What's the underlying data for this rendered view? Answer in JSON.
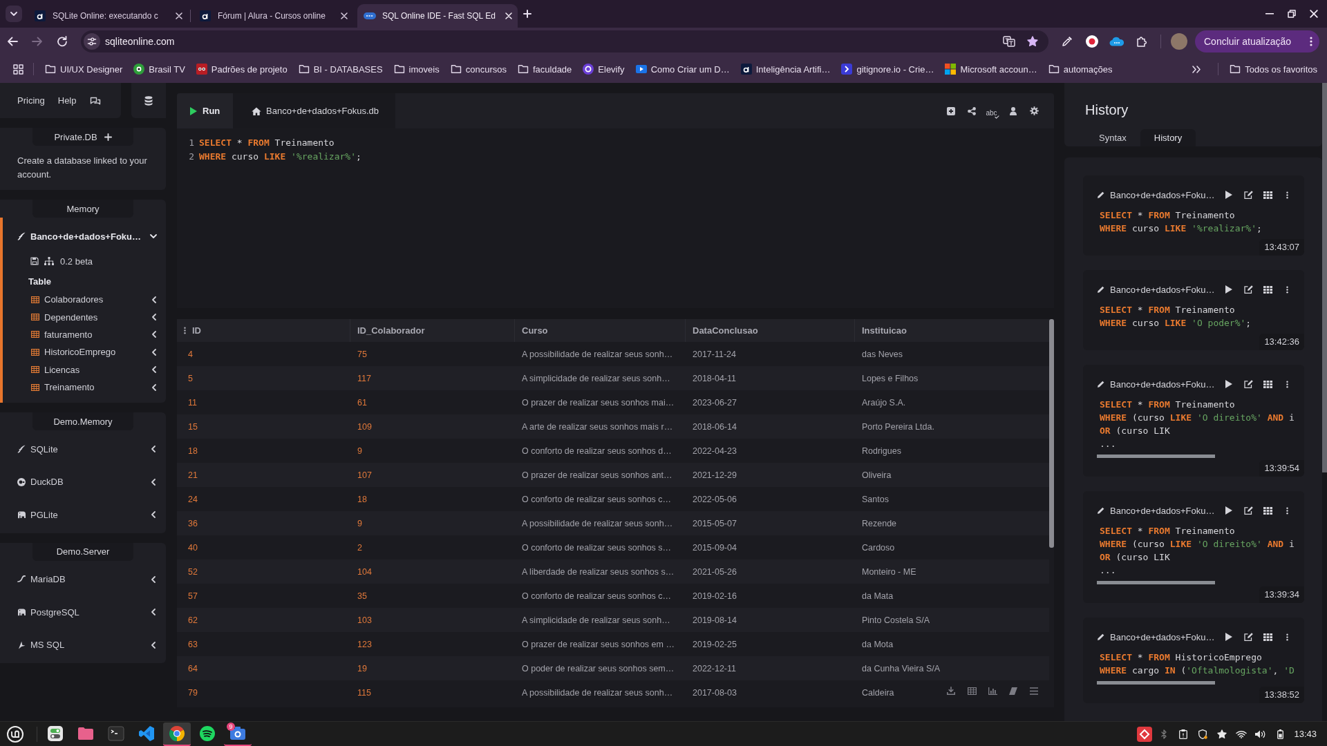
{
  "browser": {
    "tabs": [
      {
        "title": "SQLite Online: executando c",
        "selected": false
      },
      {
        "title": "Fórum | Alura - Cursos online",
        "selected": false
      },
      {
        "title": "SQL Online IDE - Fast SQL Ed",
        "selected": true
      }
    ],
    "can_go_forward": false,
    "address": "sqliteonline.com",
    "bookmarked": true,
    "update_button": "Concluir atualização",
    "bookmarks": [
      {
        "label": "UI/UX Designer",
        "kind": "folder"
      },
      {
        "label": "Brasil TV",
        "kind": "site"
      },
      {
        "label": "Padrões de projeto",
        "kind": "site"
      },
      {
        "label": "BI - DATABASES",
        "kind": "folder"
      },
      {
        "label": "imoveis",
        "kind": "folder"
      },
      {
        "label": "concursos",
        "kind": "folder"
      },
      {
        "label": "faculdade",
        "kind": "folder"
      },
      {
        "label": "Elevify",
        "kind": "site"
      },
      {
        "label": "Como Criar um D…",
        "kind": "site"
      },
      {
        "label": "Inteligência Artifi…",
        "kind": "site"
      },
      {
        "label": "gitignore.io - Crie…",
        "kind": "site"
      },
      {
        "label": "Microsoft accoun…",
        "kind": "site"
      },
      {
        "label": "automações",
        "kind": "folder"
      }
    ],
    "all_bookmarks": "Todos os favoritos"
  },
  "sidebar": {
    "nav": [
      "Pricing",
      "Help"
    ],
    "sections": [
      {
        "title": "Private.DB",
        "kind": "private",
        "text": "Create a database linked to your account."
      },
      {
        "title": "Memory",
        "kind": "databases",
        "databases": [
          {
            "name": "Banco+de+dados+Foku…",
            "selected": true,
            "expanded": true,
            "version": "0.2 beta",
            "group": "Table",
            "tables": [
              {
                "name": "Colaboradores",
                "expanded": false
              },
              {
                "name": "Dependentes",
                "expanded": false
              },
              {
                "name": "faturamento",
                "expanded": false
              },
              {
                "name": "HistoricoEmprego",
                "expanded": false
              },
              {
                "name": "Licencas",
                "expanded": false
              },
              {
                "name": "Treinamento",
                "expanded": false
              }
            ]
          }
        ]
      },
      {
        "title": "Demo.Memory",
        "kind": "engines",
        "engines": [
          {
            "name": "SQLite",
            "kind": "sqlite",
            "expanded": false
          },
          {
            "name": "DuckDB",
            "kind": "duckdb",
            "expanded": false
          },
          {
            "name": "PGLite",
            "kind": "pglite",
            "expanded": false
          }
        ]
      },
      {
        "title": "Demo.Server",
        "kind": "engines",
        "engines": [
          {
            "name": "MariaDB",
            "kind": "mariadb",
            "expanded": false
          },
          {
            "name": "PostgreSQL",
            "kind": "postgresql",
            "expanded": false
          },
          {
            "name": "MS SQL",
            "kind": "mssql",
            "expanded": false
          }
        ]
      }
    ]
  },
  "editor": {
    "run_label": "Run",
    "file_tab": "Banco+de+dados+Fokus.db",
    "spellcheck_label": "abc",
    "lines": [
      {
        "number": "1",
        "tokens": [
          {
            "kind": "keyword",
            "text": "SELECT"
          },
          {
            "kind": "plain",
            "text": " * "
          },
          {
            "kind": "keyword",
            "text": "FROM"
          },
          {
            "kind": "plain",
            "text": " Treinamento"
          }
        ]
      },
      {
        "number": "2",
        "tokens": [
          {
            "kind": "keyword",
            "text": "WHERE"
          },
          {
            "kind": "plain",
            "text": " curso "
          },
          {
            "kind": "keyword",
            "text": "LIKE"
          },
          {
            "kind": "string",
            "text": " '%realizar%'"
          },
          {
            "kind": "plain",
            "text": ";"
          }
        ]
      }
    ]
  },
  "results": {
    "columns": [
      {
        "label": "ID",
        "kind": "number"
      },
      {
        "label": "ID_Colaborador",
        "kind": "number"
      },
      {
        "label": "Curso",
        "kind": "text"
      },
      {
        "label": "DataConclusao",
        "kind": "date"
      },
      {
        "label": "Instituicao",
        "kind": "text"
      }
    ],
    "rows": [
      [
        "4",
        "75",
        "A possibilidade de realizar seus sonh…",
        "2017-11-24",
        "das Neves"
      ],
      [
        "5",
        "117",
        "A simplicidade de realizar seus sonh…",
        "2018-04-11",
        "Lopes e Filhos"
      ],
      [
        "11",
        "61",
        "O prazer de realizar seus sonhos mai…",
        "2023-06-27",
        "Araújo S.A."
      ],
      [
        "15",
        "109",
        "A arte de realizar seus sonhos mais r…",
        "2018-06-14",
        "Porto Pereira Ltda."
      ],
      [
        "18",
        "9",
        "O conforto de realizar seus sonhos d…",
        "2022-04-23",
        "Rodrigues"
      ],
      [
        "21",
        "107",
        "O prazer de realizar seus sonhos ant…",
        "2021-12-29",
        "Oliveira"
      ],
      [
        "24",
        "18",
        "O conforto de realizar seus sonhos c…",
        "2022-05-06",
        "Santos"
      ],
      [
        "36",
        "9",
        "A possibilidade de realizar seus sonh…",
        "2015-05-07",
        "Rezende"
      ],
      [
        "40",
        "2",
        "O conforto de realizar seus sonhos s…",
        "2015-09-04",
        "Cardoso"
      ],
      [
        "52",
        "104",
        "A liberdade de realizar seus sonhos s…",
        "2021-05-26",
        "Monteiro - ME"
      ],
      [
        "57",
        "35",
        "O conforto de realizar seus sonhos c…",
        "2019-02-16",
        "da Mata"
      ],
      [
        "62",
        "103",
        "A simplicidade de realizar seus sonh…",
        "2019-08-14",
        "Pinto Costela S/A"
      ],
      [
        "63",
        "123",
        "O prazer de realizar seus sonhos em …",
        "2019-02-25",
        "da Mota"
      ],
      [
        "64",
        "19",
        "O poder de realizar seus sonhos sem…",
        "2022-12-11",
        "da Cunha Vieira S/A"
      ],
      [
        "79",
        "115",
        "A possibilidade de realizar seus sonh…",
        "2017-08-03",
        "Caldeira"
      ]
    ]
  },
  "history": {
    "title": "History",
    "tabs": [
      {
        "label": "Syntax",
        "selected": false
      },
      {
        "label": "History",
        "selected": true
      }
    ],
    "entries": [
      {
        "database": "Banco+de+dados+Foku…",
        "scrollable": false,
        "time": "13:43:07",
        "lines": [
          [
            {
              "kind": "keyword",
              "text": "SELECT"
            },
            {
              "kind": "plain",
              "text": " * "
            },
            {
              "kind": "keyword",
              "text": "FROM"
            },
            {
              "kind": "plain",
              "text": " Treinamento"
            }
          ],
          [
            {
              "kind": "keyword",
              "text": "WHERE"
            },
            {
              "kind": "plain",
              "text": " curso "
            },
            {
              "kind": "keyword",
              "text": "LIKE"
            },
            {
              "kind": "string",
              "text": " '%realizar%'"
            },
            {
              "kind": "plain",
              "text": ";"
            }
          ]
        ]
      },
      {
        "database": "Banco+de+dados+Foku…",
        "scrollable": false,
        "time": "13:42:36",
        "lines": [
          [
            {
              "kind": "keyword",
              "text": "SELECT"
            },
            {
              "kind": "plain",
              "text": " * "
            },
            {
              "kind": "keyword",
              "text": "FROM"
            },
            {
              "kind": "plain",
              "text": " Treinamento"
            }
          ],
          [
            {
              "kind": "keyword",
              "text": "WHERE"
            },
            {
              "kind": "plain",
              "text": " curso "
            },
            {
              "kind": "keyword",
              "text": "LIKE"
            },
            {
              "kind": "string",
              "text": " 'O poder%'"
            },
            {
              "kind": "plain",
              "text": ";"
            }
          ]
        ]
      },
      {
        "database": "Banco+de+dados+Foku…",
        "scrollable": true,
        "time": "13:39:54",
        "lines": [
          [
            {
              "kind": "keyword",
              "text": "SELECT"
            },
            {
              "kind": "plain",
              "text": " * "
            },
            {
              "kind": "keyword",
              "text": "FROM"
            },
            {
              "kind": "plain",
              "text": " Treinamento"
            }
          ],
          [
            {
              "kind": "keyword",
              "text": "WHERE"
            },
            {
              "kind": "plain",
              "text": " (curso "
            },
            {
              "kind": "keyword",
              "text": "LIKE"
            },
            {
              "kind": "string",
              "text": " 'O direito%'"
            },
            {
              "kind": "keyword",
              "text": " AND"
            },
            {
              "kind": "plain",
              "text": " i"
            }
          ],
          [
            {
              "kind": "keyword",
              "text": "OR"
            },
            {
              "kind": "plain",
              "text": " (curso LIK"
            }
          ],
          [
            {
              "kind": "plain",
              "text": "..."
            }
          ]
        ]
      },
      {
        "database": "Banco+de+dados+Foku…",
        "scrollable": true,
        "time": "13:39:34",
        "lines": [
          [
            {
              "kind": "keyword",
              "text": "SELECT"
            },
            {
              "kind": "plain",
              "text": " * "
            },
            {
              "kind": "keyword",
              "text": "FROM"
            },
            {
              "kind": "plain",
              "text": " Treinamento"
            }
          ],
          [
            {
              "kind": "keyword",
              "text": "WHERE"
            },
            {
              "kind": "plain",
              "text": " (curso "
            },
            {
              "kind": "keyword",
              "text": "LIKE"
            },
            {
              "kind": "string",
              "text": " 'O direito%'"
            },
            {
              "kind": "keyword",
              "text": " AND"
            },
            {
              "kind": "plain",
              "text": " i"
            }
          ],
          [
            {
              "kind": "keyword",
              "text": "OR"
            },
            {
              "kind": "plain",
              "text": " (curso LIK"
            }
          ],
          [
            {
              "kind": "plain",
              "text": "..."
            }
          ]
        ]
      },
      {
        "database": "Banco+de+dados+Foku…",
        "scrollable": true,
        "time": "13:38:52",
        "lines": [
          [
            {
              "kind": "keyword",
              "text": "SELECT"
            },
            {
              "kind": "plain",
              "text": " * "
            },
            {
              "kind": "keyword",
              "text": "FROM"
            },
            {
              "kind": "plain",
              "text": " HistoricoEmprego"
            }
          ],
          [
            {
              "kind": "keyword",
              "text": "WHERE"
            },
            {
              "kind": "plain",
              "text": " cargo "
            },
            {
              "kind": "keyword",
              "text": "IN"
            },
            {
              "kind": "plain",
              "text": " ("
            },
            {
              "kind": "string",
              "text": "'Oftalmologista'"
            },
            {
              "kind": "plain",
              "text": ", "
            },
            {
              "kind": "string",
              "text": "'D"
            }
          ]
        ]
      }
    ]
  },
  "taskbar": {
    "apps": [
      {
        "kind": "settings",
        "selected": false,
        "running": false
      },
      {
        "kind": "files",
        "selected": false,
        "running": false
      },
      {
        "kind": "terminal",
        "selected": false,
        "running": false
      },
      {
        "kind": "editor",
        "selected": false,
        "running": false
      },
      {
        "kind": "browser",
        "selected": true,
        "running": true
      },
      {
        "kind": "music",
        "selected": false,
        "running": false
      },
      {
        "kind": "camera",
        "selected": false,
        "running": true,
        "badge": "9"
      }
    ],
    "clock": "13:43"
  }
}
